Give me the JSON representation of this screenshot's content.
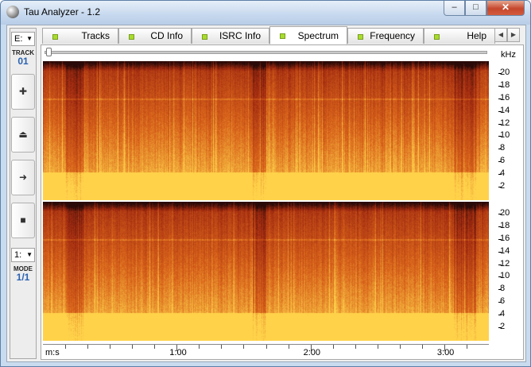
{
  "window": {
    "title": "Tau Analyzer - 1.2",
    "min_icon": "minimize-icon",
    "max_icon": "maximize-icon",
    "close_icon": "close-icon"
  },
  "sidebar": {
    "drive": "E:",
    "track_label": "TRACK",
    "track_number": "01",
    "buttons": [
      "add-icon",
      "eject-icon",
      "play-icon",
      "stop-icon"
    ],
    "mode_combo": "1:",
    "mode_label": "MODE",
    "mode_value": "1/1"
  },
  "tabs": [
    {
      "label": "Tracks",
      "active": false
    },
    {
      "label": "CD Info",
      "active": false
    },
    {
      "label": "ISRC Info",
      "active": false
    },
    {
      "label": "Spectrum",
      "active": true
    },
    {
      "label": "Frequency",
      "active": false
    },
    {
      "label": "Help",
      "active": false
    }
  ],
  "spectrum": {
    "unit_label": "kHz",
    "y_ticks": [
      "20",
      "18",
      "16",
      "14",
      "12",
      "10",
      "8",
      "6",
      "4",
      "2"
    ],
    "y_max": 22,
    "time_axis_label": "m:s",
    "time_ticks": [
      "1:00",
      "2:00",
      "3:00"
    ],
    "duration_seconds": 200,
    "channels": 2,
    "colors": {
      "low": "#ffd24a",
      "mid": "#d8621a",
      "high": "#a02a10",
      "top": "#2a0a08"
    }
  }
}
